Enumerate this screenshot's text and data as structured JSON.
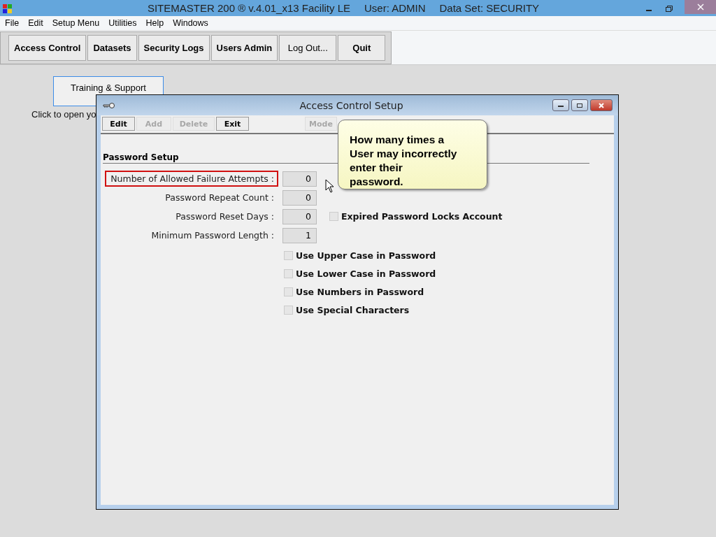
{
  "app_window": {
    "title": "SITEMASTER 200 ® v.4.01_x13 Facility LE",
    "user": "User: ADMIN",
    "dataset": "Data Set: SECURITY"
  },
  "menu": [
    "File",
    "Edit",
    "Setup Menu",
    "Utilities",
    "Help",
    "Windows"
  ],
  "toolbar": [
    {
      "label": "Access Control",
      "bold": true
    },
    {
      "label": "Datasets",
      "bold": true
    },
    {
      "label": "Security Logs",
      "bold": true
    },
    {
      "label": "Users Admin",
      "bold": true
    },
    {
      "label": "Log Out...",
      "bold": false
    },
    {
      "label": "Quit",
      "bold": true
    }
  ],
  "training_button": "Training & Support",
  "training_hint": "Click to open yo",
  "dialog": {
    "title": "Access Control Setup",
    "buttons": [
      {
        "label": "Edit",
        "disabled": false
      },
      {
        "label": "Add",
        "disabled": true
      },
      {
        "label": "Delete",
        "disabled": true
      },
      {
        "label": "Exit",
        "disabled": false
      }
    ],
    "mode_button": {
      "label": "Mode",
      "disabled": true
    },
    "section": "Password Setup",
    "fields": [
      {
        "label": "Number of Allowed Failure Attempts :",
        "value": "0",
        "highlighted": true
      },
      {
        "label": "Password Repeat Count :",
        "value": "0",
        "highlighted": false
      },
      {
        "label": "Password Reset Days :",
        "value": "0",
        "highlighted": false,
        "checkbox": {
          "label": "Expired Password Locks Account",
          "checked": false
        }
      },
      {
        "label": "Minimum Password Length :",
        "value": "1",
        "highlighted": false
      }
    ],
    "checkboxes": [
      {
        "label": "Use Upper Case in Password",
        "checked": false
      },
      {
        "label": "Use Lower Case in Password",
        "checked": false
      },
      {
        "label": "Use Numbers in Password",
        "checked": false
      },
      {
        "label": "Use Special Characters",
        "checked": false
      }
    ]
  },
  "tooltip": "How many times a User may incorrectly enter their password."
}
